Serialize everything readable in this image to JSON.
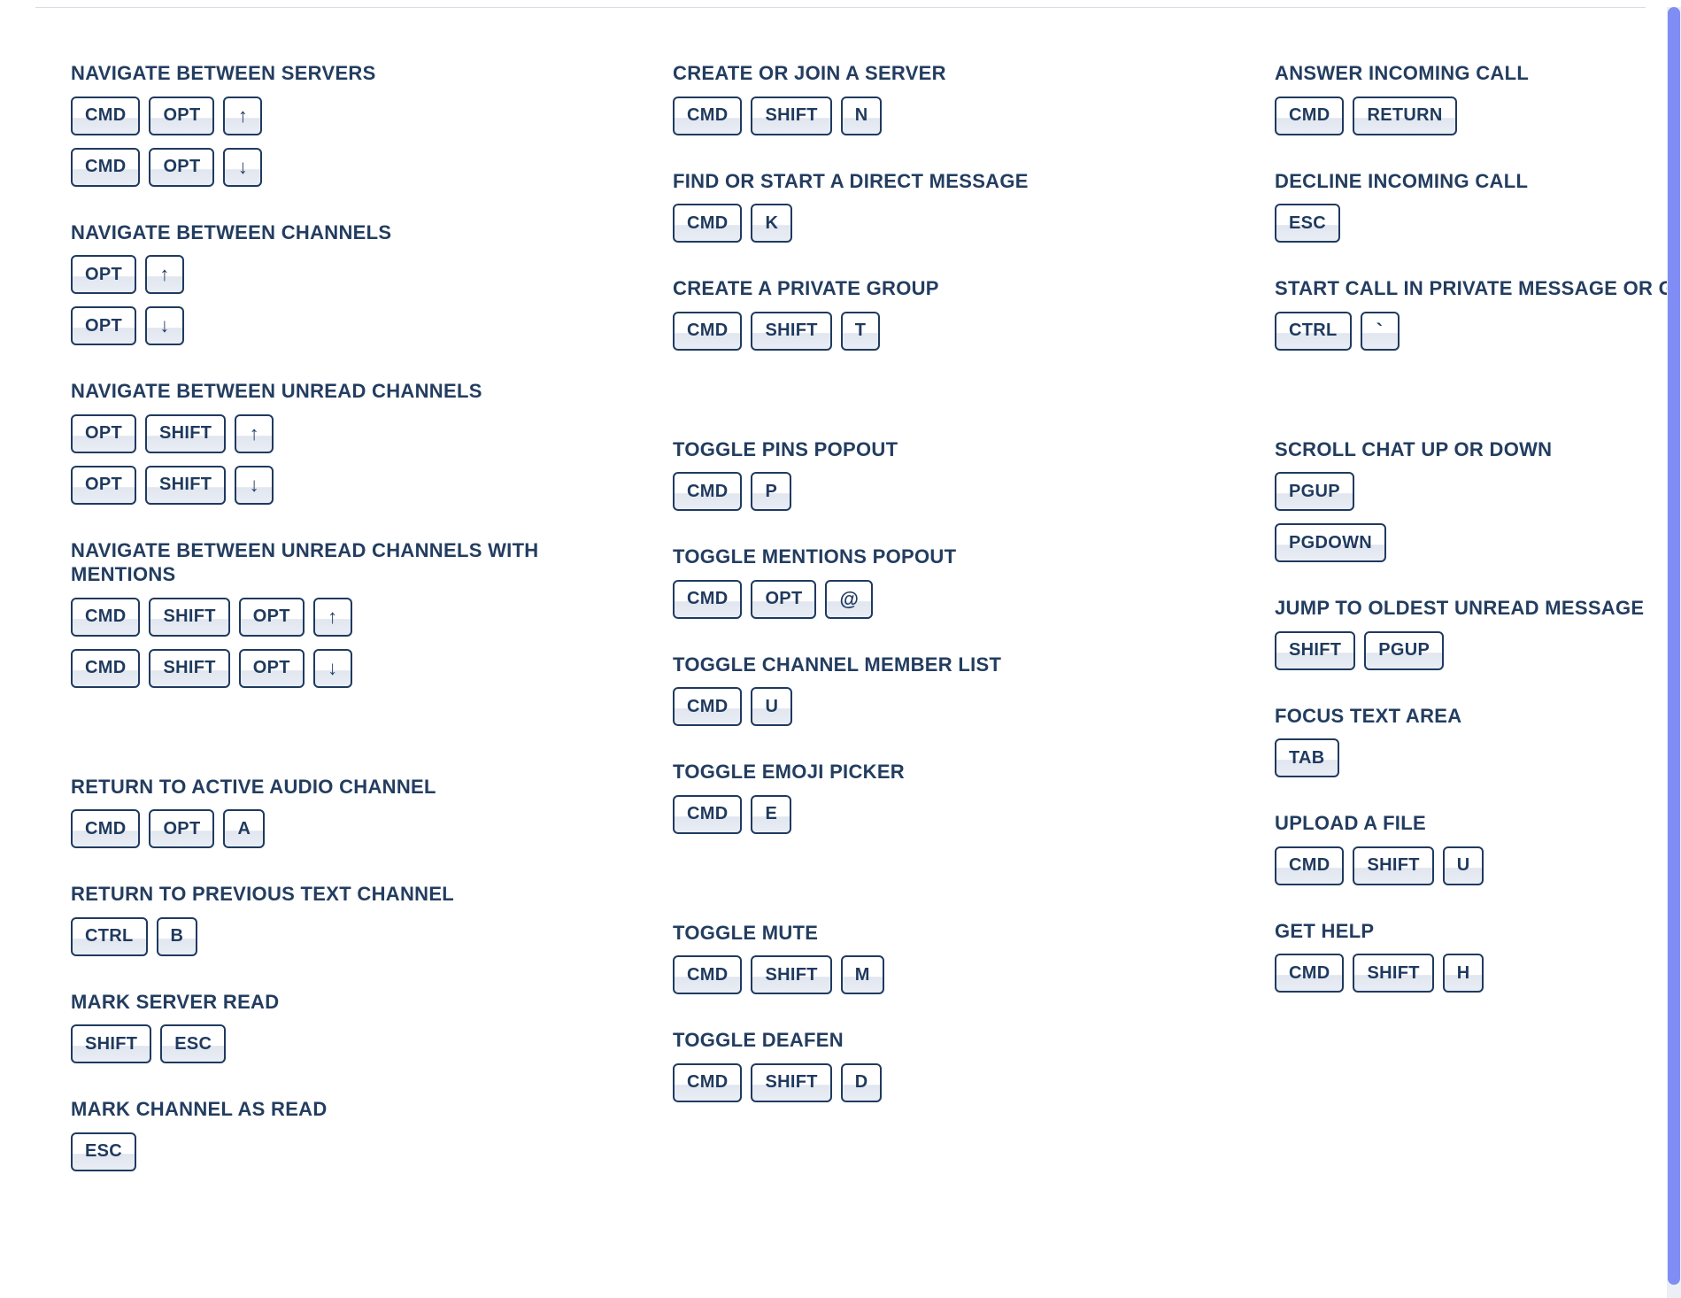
{
  "columns": [
    [
      {
        "title": "NAVIGATE BETWEEN SERVERS",
        "bindings": [
          [
            "CMD",
            "OPT",
            "↑"
          ],
          [
            "CMD",
            "OPT",
            "↓"
          ]
        ]
      },
      {
        "title": "NAVIGATE BETWEEN CHANNELS",
        "bindings": [
          [
            "OPT",
            "↑"
          ],
          [
            "OPT",
            "↓"
          ]
        ]
      },
      {
        "title": "NAVIGATE BETWEEN UNREAD CHANNELS",
        "bindings": [
          [
            "OPT",
            "SHIFT",
            "↑"
          ],
          [
            "OPT",
            "SHIFT",
            "↓"
          ]
        ]
      },
      {
        "title": "NAVIGATE BETWEEN UNREAD CHANNELS WITH MENTIONS",
        "bindings": [
          [
            "CMD",
            "SHIFT",
            "OPT",
            "↑"
          ],
          [
            "CMD",
            "SHIFT",
            "OPT",
            "↓"
          ]
        ]
      },
      {
        "gap": true
      },
      {
        "title": "RETURN TO ACTIVE AUDIO CHANNEL",
        "bindings": [
          [
            "CMD",
            "OPT",
            "A"
          ]
        ]
      },
      {
        "title": "RETURN TO PREVIOUS TEXT CHANNEL",
        "bindings": [
          [
            "CTRL",
            "B"
          ]
        ]
      },
      {
        "title": "MARK SERVER READ",
        "bindings": [
          [
            "SHIFT",
            "ESC"
          ]
        ]
      },
      {
        "title": "MARK CHANNEL AS READ",
        "bindings": [
          [
            "ESC"
          ]
        ]
      }
    ],
    [
      {
        "title": "CREATE OR JOIN A SERVER",
        "bindings": [
          [
            "CMD",
            "SHIFT",
            "N"
          ]
        ]
      },
      {
        "title": "FIND OR START A DIRECT MESSAGE",
        "bindings": [
          [
            "CMD",
            "K"
          ]
        ]
      },
      {
        "title": "CREATE A PRIVATE GROUP",
        "bindings": [
          [
            "CMD",
            "SHIFT",
            "T"
          ]
        ]
      },
      {
        "gap": true
      },
      {
        "title": "TOGGLE PINS POPOUT",
        "bindings": [
          [
            "CMD",
            "P"
          ]
        ]
      },
      {
        "title": "TOGGLE MENTIONS POPOUT",
        "bindings": [
          [
            "CMD",
            "OPT",
            "@"
          ]
        ]
      },
      {
        "title": "TOGGLE CHANNEL MEMBER LIST",
        "bindings": [
          [
            "CMD",
            "U"
          ]
        ]
      },
      {
        "title": "TOGGLE EMOJI PICKER",
        "bindings": [
          [
            "CMD",
            "E"
          ]
        ]
      },
      {
        "gap": true
      },
      {
        "title": "TOGGLE MUTE",
        "bindings": [
          [
            "CMD",
            "SHIFT",
            "M"
          ]
        ]
      },
      {
        "title": "TOGGLE DEAFEN",
        "bindings": [
          [
            "CMD",
            "SHIFT",
            "D"
          ]
        ]
      }
    ],
    [
      {
        "title": "ANSWER INCOMING CALL",
        "bindings": [
          [
            "CMD",
            "RETURN"
          ]
        ]
      },
      {
        "title": "DECLINE INCOMING CALL",
        "bindings": [
          [
            "ESC"
          ]
        ]
      },
      {
        "title": "START CALL IN PRIVATE MESSAGE OR GROUP",
        "bindings": [
          [
            "CTRL",
            "`"
          ]
        ]
      },
      {
        "gap": true
      },
      {
        "title": "SCROLL CHAT UP OR DOWN",
        "bindings": [
          [
            "PGUP"
          ],
          [
            "PGDOWN"
          ]
        ]
      },
      {
        "title": "JUMP TO OLDEST UNREAD MESSAGE",
        "bindings": [
          [
            "SHIFT",
            "PGUP"
          ]
        ]
      },
      {
        "title": "FOCUS TEXT AREA",
        "bindings": [
          [
            "TAB"
          ]
        ]
      },
      {
        "title": "UPLOAD A FILE",
        "bindings": [
          [
            "CMD",
            "SHIFT",
            "U"
          ]
        ]
      },
      {
        "title": "GET HELP",
        "bindings": [
          [
            "CMD",
            "SHIFT",
            "H"
          ]
        ]
      }
    ]
  ],
  "scrollbar": {
    "top_pct": 0,
    "height_pct": 99
  }
}
